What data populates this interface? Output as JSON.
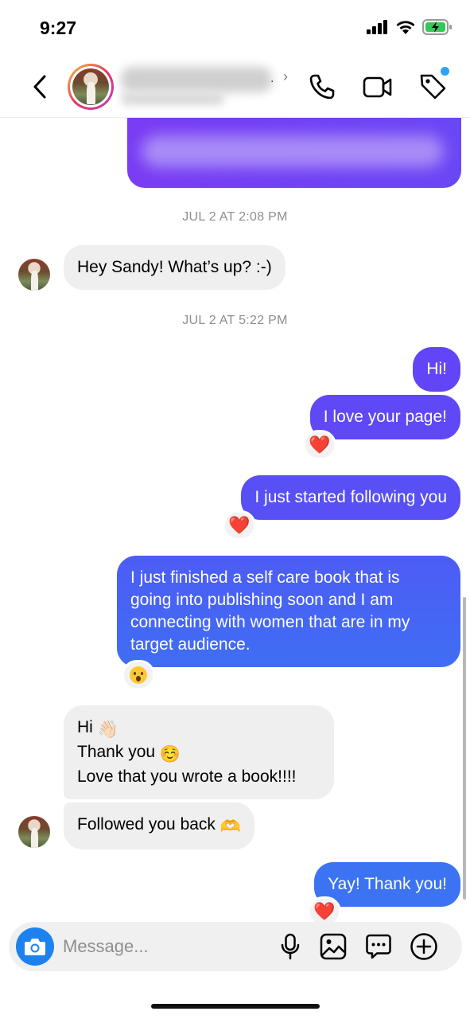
{
  "status_bar": {
    "time": "9:27"
  },
  "header": {
    "contact_name": "",
    "back_label": "Back",
    "icons": [
      "chevron-left-icon",
      "phone-icon",
      "video-camera-icon",
      "tag-icon"
    ]
  },
  "chat": {
    "timestamps": [
      "JUL 2 AT 2:08 PM",
      "JUL 2 AT 5:22 PM"
    ],
    "messages": [
      {
        "side": "in",
        "text": "Hey Sandy! What’s up? :-)"
      },
      {
        "side": "out",
        "text": "Hi!"
      },
      {
        "side": "out",
        "text": "I love your page!",
        "reaction": "❤️"
      },
      {
        "side": "out",
        "text": "I just started following you",
        "reaction": "❤️"
      },
      {
        "side": "out",
        "lines": [
          "I just finished a self care book that is",
          "going into publishing soon and I am",
          "connecting with women that are in my",
          "target audience."
        ],
        "reaction": "😮"
      },
      {
        "side": "in",
        "lines": [
          "Hi",
          "Thank you",
          "Love that you wrote a book!!!!"
        ],
        "emojis": [
          "👋🏻",
          "☺️"
        ]
      },
      {
        "side": "in",
        "text": "Followed you back",
        "emoji": "🫶"
      },
      {
        "side": "out",
        "text": "Yay! Thank you!",
        "reaction": "❤️"
      }
    ]
  },
  "composer": {
    "placeholder": "Message...",
    "icons": [
      "camera-icon",
      "microphone-icon",
      "gallery-icon",
      "sticker-icon",
      "plus-icon"
    ]
  },
  "colors": {
    "outgoing_top": "#6444f6",
    "outgoing_bottom": "#3c70f3",
    "incoming": "#efefef",
    "camera_button": "#1d82f0"
  }
}
